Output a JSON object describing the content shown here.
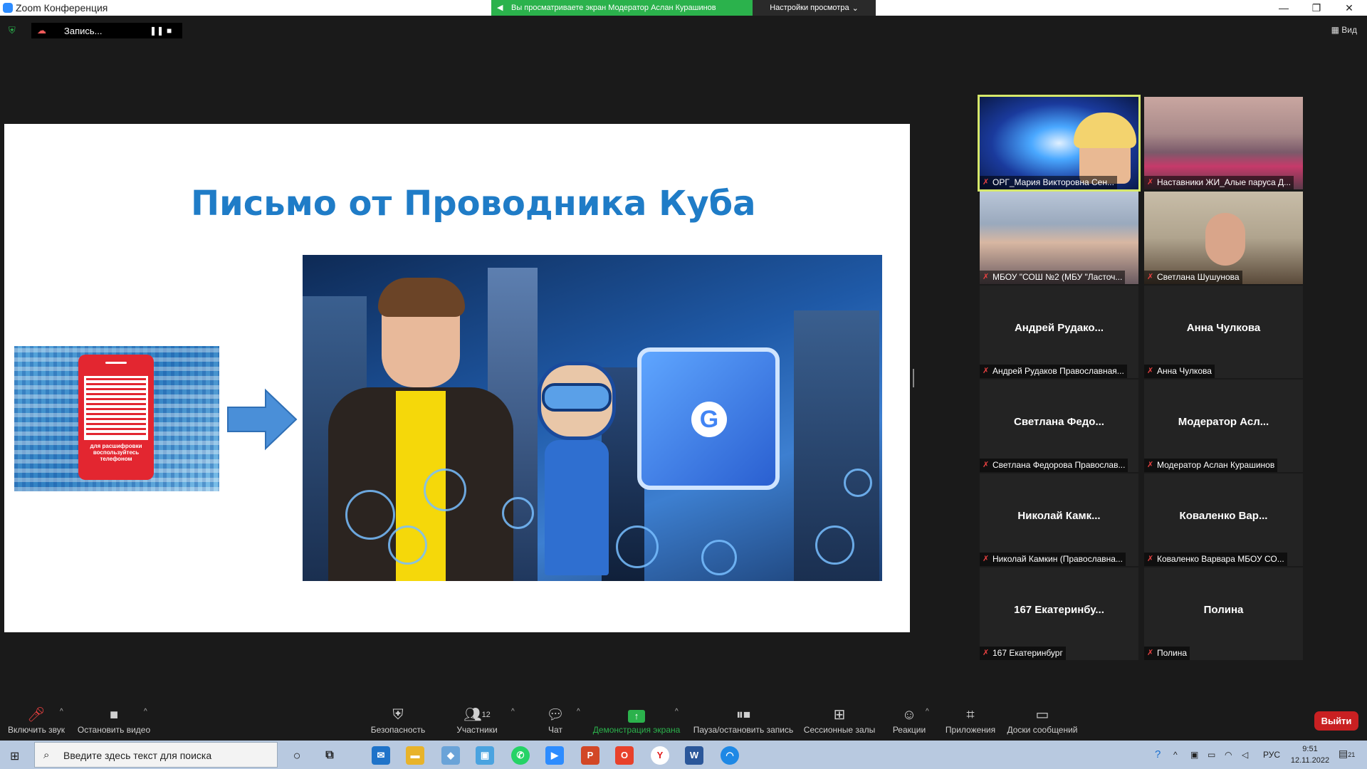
{
  "window": {
    "title": "Zoom Конференция",
    "share_banner": "Вы просматриваете экран Модератор Аслан Курашинов",
    "view_settings": "Настройки просмотра"
  },
  "recording": {
    "label": "Запись..."
  },
  "view_button": "Вид",
  "slide": {
    "title": "Письмо от Проводника Куба",
    "qr_caption": "для расшифровки воспользуйтесь телефоном"
  },
  "participants": [
    {
      "big_name": "",
      "label": "ОРГ_Мария Викторовна Сен..."
    },
    {
      "big_name": "",
      "label": "Наставники ЖИ_Алые паруса Д..."
    },
    {
      "big_name": "",
      "label": "МБОУ \"СОШ №2 (МБУ \"Ласточ..."
    },
    {
      "big_name": "",
      "label": "Светлана Шушунова"
    },
    {
      "big_name": "Андрей  Рудако...",
      "label": "Андрей Рудаков Православная..."
    },
    {
      "big_name": "Анна Чулкова",
      "label": "Анна Чулкова"
    },
    {
      "big_name": "Светлана  Федо...",
      "label": "Светлана Федорова Православ..."
    },
    {
      "big_name": "Модератор  Асл...",
      "label": "Модератор Аслан Курашинов"
    },
    {
      "big_name": "Николай  Камк...",
      "label": "Николай Камкин (Православна..."
    },
    {
      "big_name": "Коваленко  Вар...",
      "label": "Коваленко Варвара МБОУ СО..."
    },
    {
      "big_name": "167  Екатеринбу...",
      "label": "167 Екатеринбург"
    },
    {
      "big_name": "Полина",
      "label": "Полина"
    }
  ],
  "toolbar": {
    "unmute": "Включить звук",
    "stop_video": "Остановить видео",
    "security": "Безопасность",
    "participants": "Участники",
    "participants_count": "12",
    "chat": "Чат",
    "share_screen": "Демонстрация экрана",
    "pause_recording": "Пауза/остановить запись",
    "breakout_rooms": "Сессионные залы",
    "reactions": "Реакции",
    "apps": "Приложения",
    "whiteboards": "Доски сообщений",
    "leave": "Выйти"
  },
  "taskbar": {
    "search_placeholder": "Введите здесь текст для поиска",
    "language": "РУС",
    "time": "9:51",
    "date": "12.11.2022",
    "notifications": "21"
  },
  "colors": {
    "share_green": "#2bb24c",
    "slide_title_blue": "#1f7cc7",
    "leave_red": "#c92022",
    "active_speaker": "#d6e86a"
  }
}
